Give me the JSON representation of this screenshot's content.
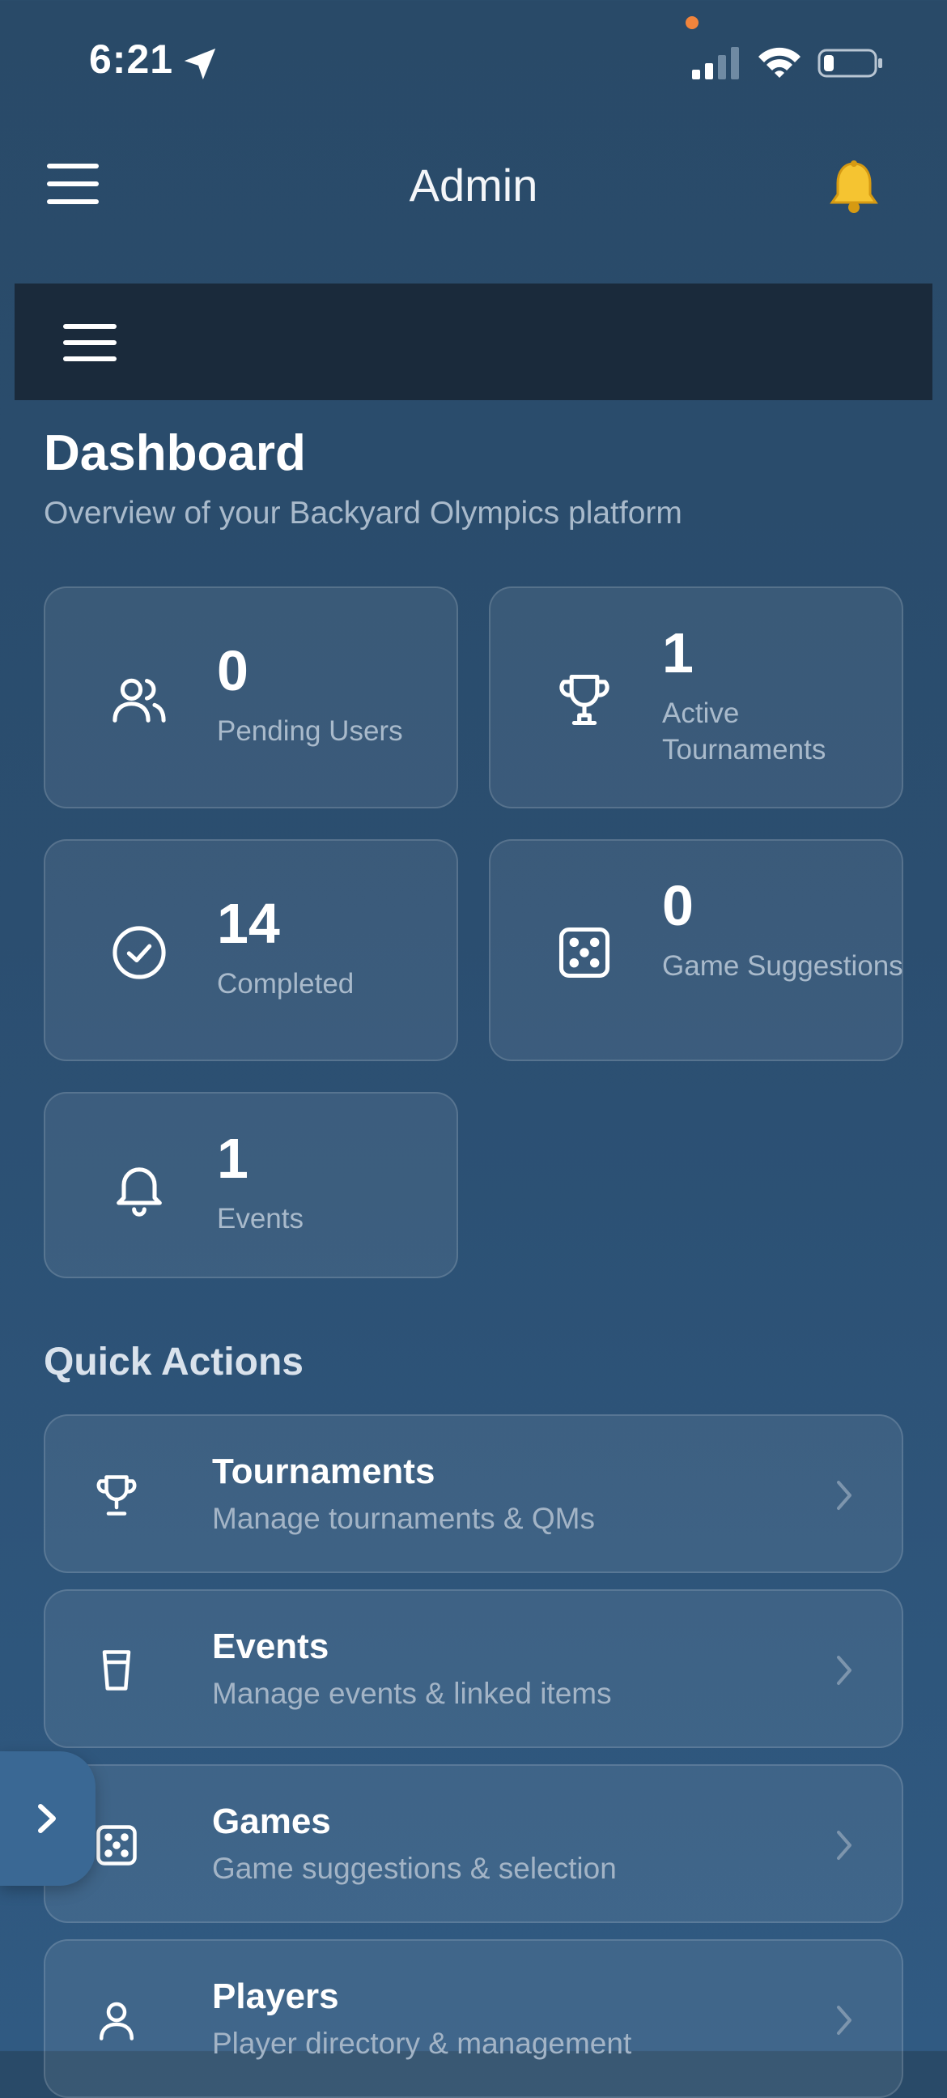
{
  "status_bar": {
    "time": "6:21"
  },
  "header": {
    "title": "Admin",
    "menu_icon": "hamburger-icon",
    "bell_icon": "bell-icon"
  },
  "dashboard": {
    "title": "Dashboard",
    "subtitle": "Overview of your Backyard Olympics platform"
  },
  "stats": [
    {
      "icon": "users-icon",
      "value": "0",
      "label": "Pending Users"
    },
    {
      "icon": "trophy-icon",
      "value": "1",
      "label": "Active Tournaments"
    },
    {
      "icon": "check-circle-icon",
      "value": "14",
      "label": "Completed"
    },
    {
      "icon": "dice-icon",
      "value": "0",
      "label": "Game Suggestions"
    },
    {
      "icon": "bell-icon",
      "value": "1",
      "label": "Events"
    }
  ],
  "quick_actions": {
    "title": "Quick Actions",
    "items": [
      {
        "icon": "trophy-icon",
        "title": "Tournaments",
        "subtitle": "Manage tournaments & QMs"
      },
      {
        "icon": "cup-icon",
        "title": "Events",
        "subtitle": "Manage events & linked items"
      },
      {
        "icon": "dice-icon",
        "title": "Games",
        "subtitle": "Game suggestions & selection"
      },
      {
        "icon": "user-icon",
        "title": "Players",
        "subtitle": "Player directory & management"
      }
    ]
  },
  "colors": {
    "background": "#2b4e70",
    "dark_bar": "#1a2a3b",
    "muted_text": "#a9bacb",
    "notification_dot": "#f0843c"
  }
}
